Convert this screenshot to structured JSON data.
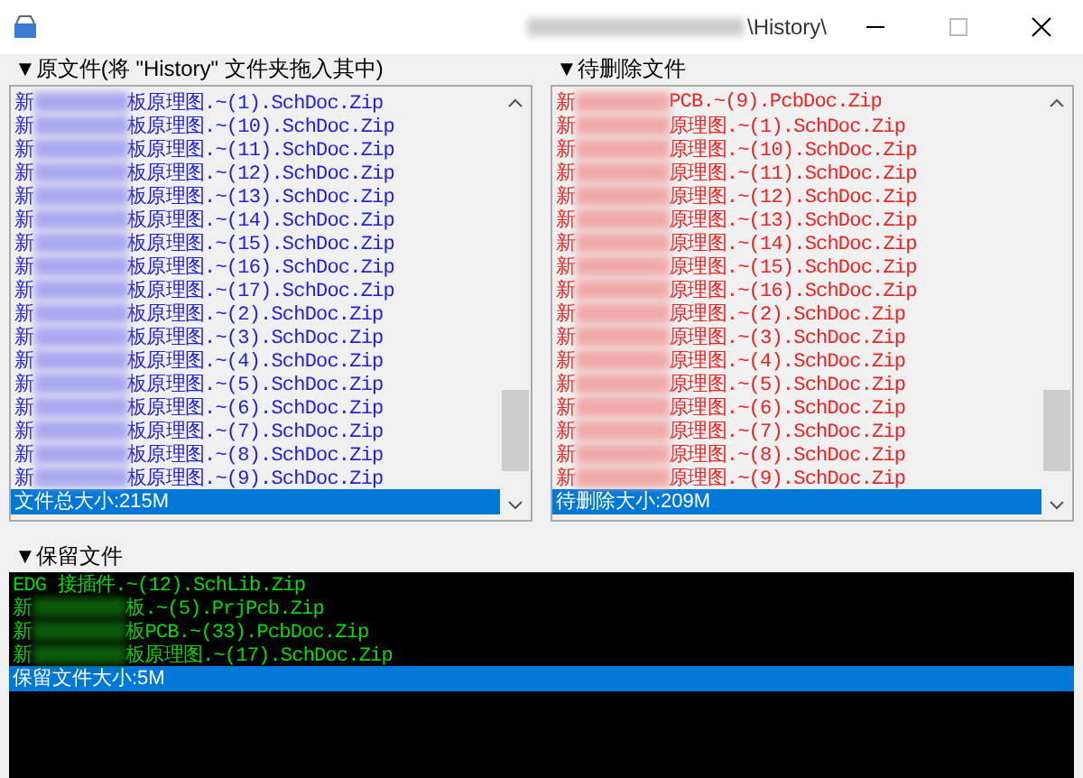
{
  "window": {
    "title": "\\History\\"
  },
  "source": {
    "label": "▼原文件(将 \"History\" 文件夹拖入其中)",
    "items": [
      {
        "prefix": "新",
        "blurred": true,
        "suffix": "板原理图.~(1).SchDoc.Zip"
      },
      {
        "prefix": "新",
        "blurred": true,
        "suffix": "板原理图.~(10).SchDoc.Zip"
      },
      {
        "prefix": "新",
        "blurred": true,
        "suffix": "板原理图.~(11).SchDoc.Zip"
      },
      {
        "prefix": "新",
        "blurred": true,
        "suffix": "板原理图.~(12).SchDoc.Zip"
      },
      {
        "prefix": "新",
        "blurred": true,
        "suffix": "板原理图.~(13).SchDoc.Zip"
      },
      {
        "prefix": "新",
        "blurred": true,
        "suffix": "板原理图.~(14).SchDoc.Zip"
      },
      {
        "prefix": "新",
        "blurred": true,
        "suffix": "板原理图.~(15).SchDoc.Zip"
      },
      {
        "prefix": "新",
        "blurred": true,
        "suffix": "板原理图.~(16).SchDoc.Zip"
      },
      {
        "prefix": "新",
        "blurred": true,
        "suffix": "板原理图.~(17).SchDoc.Zip"
      },
      {
        "prefix": "新",
        "blurred": true,
        "suffix": "板原理图.~(2).SchDoc.Zip"
      },
      {
        "prefix": "新",
        "blurred": true,
        "suffix": "板原理图.~(3).SchDoc.Zip"
      },
      {
        "prefix": "新",
        "blurred": true,
        "suffix": "板原理图.~(4).SchDoc.Zip"
      },
      {
        "prefix": "新",
        "blurred": true,
        "suffix": "板原理图.~(5).SchDoc.Zip"
      },
      {
        "prefix": "新",
        "blurred": true,
        "suffix": "板原理图.~(6).SchDoc.Zip"
      },
      {
        "prefix": "新",
        "blurred": true,
        "suffix": "板原理图.~(7).SchDoc.Zip"
      },
      {
        "prefix": "新",
        "blurred": true,
        "suffix": "板原理图.~(8).SchDoc.Zip"
      },
      {
        "prefix": "新",
        "blurred": true,
        "suffix": "板原理图.~(9).SchDoc.Zip"
      }
    ],
    "summary": "文件总大小:215M"
  },
  "pending": {
    "label": "▼待删除文件",
    "items": [
      {
        "prefix": "新",
        "blurred": true,
        "suffix": "PCB.~(9).PcbDoc.Zip"
      },
      {
        "prefix": "新",
        "blurred": true,
        "suffix": "原理图.~(1).SchDoc.Zip"
      },
      {
        "prefix": "新",
        "blurred": true,
        "suffix": "原理图.~(10).SchDoc.Zip"
      },
      {
        "prefix": "新",
        "blurred": true,
        "suffix": "原理图.~(11).SchDoc.Zip"
      },
      {
        "prefix": "新",
        "blurred": true,
        "suffix": "原理图.~(12).SchDoc.Zip"
      },
      {
        "prefix": "新",
        "blurred": true,
        "suffix": "原理图.~(13).SchDoc.Zip"
      },
      {
        "prefix": "新",
        "blurred": true,
        "suffix": "原理图.~(14).SchDoc.Zip"
      },
      {
        "prefix": "新",
        "blurred": true,
        "suffix": "原理图.~(15).SchDoc.Zip"
      },
      {
        "prefix": "新",
        "blurred": true,
        "suffix": "原理图.~(16).SchDoc.Zip"
      },
      {
        "prefix": "新",
        "blurred": true,
        "suffix": "原理图.~(2).SchDoc.Zip"
      },
      {
        "prefix": "新",
        "blurred": true,
        "suffix": "原理图.~(3).SchDoc.Zip"
      },
      {
        "prefix": "新",
        "blurred": true,
        "suffix": "原理图.~(4).SchDoc.Zip"
      },
      {
        "prefix": "新",
        "blurred": true,
        "suffix": "原理图.~(5).SchDoc.Zip"
      },
      {
        "prefix": "新",
        "blurred": true,
        "suffix": "原理图.~(6).SchDoc.Zip"
      },
      {
        "prefix": "新",
        "blurred": true,
        "suffix": "原理图.~(7).SchDoc.Zip"
      },
      {
        "prefix": "新",
        "blurred": true,
        "suffix": "原理图.~(8).SchDoc.Zip"
      },
      {
        "prefix": "新",
        "blurred": true,
        "suffix": "原理图.~(9).SchDoc.Zip"
      }
    ],
    "summary": "待删除大小:209M"
  },
  "kept": {
    "label": "▼保留文件",
    "items": [
      {
        "prefix": "EDG 接插件.~(12).SchLib.Zip",
        "blurred": false
      },
      {
        "prefix": "新",
        "blurred": true,
        "suffix": "板.~(5).PrjPcb.Zip"
      },
      {
        "prefix": "新",
        "blurred": true,
        "suffix": "板PCB.~(33).PcbDoc.Zip"
      },
      {
        "prefix": "新",
        "blurred": true,
        "suffix": "板原理图.~(17).SchDoc.Zip"
      }
    ],
    "summary": "保留文件大小:5M"
  }
}
